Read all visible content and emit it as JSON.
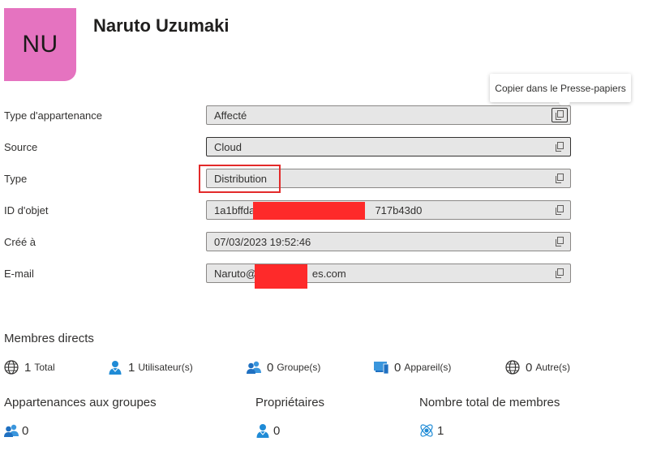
{
  "header": {
    "initials": "NU",
    "name": "Naruto Uzumaki"
  },
  "tooltip": "Copier dans le Presse-papiers",
  "fields": [
    {
      "label": "Type d'appartenance",
      "value": "Affecté"
    },
    {
      "label": "Source",
      "value": "Cloud"
    },
    {
      "label": "Type",
      "value": "Distribution"
    },
    {
      "label": "ID d'objet",
      "value": "1a1bffda                                         717b43d0"
    },
    {
      "label": "Créé à",
      "value": "07/03/2023 19:52:46"
    },
    {
      "label": "E-mail",
      "value": "Naruto@                   es.com"
    }
  ],
  "direct_members": {
    "title": "Membres directs",
    "stats": [
      {
        "icon": "globe-icon",
        "count": "1",
        "unit": "Total"
      },
      {
        "icon": "user-icon",
        "count": "1",
        "unit": "Utilisateur(s)"
      },
      {
        "icon": "group-icon",
        "count": "0",
        "unit": "Groupe(s)"
      },
      {
        "icon": "device-icon",
        "count": "0",
        "unit": "Appareil(s)"
      },
      {
        "icon": "globe-icon",
        "count": "0",
        "unit": "Autre(s)"
      }
    ]
  },
  "summary": [
    {
      "title": "Appartenances aux groupes",
      "icon": "group-icon",
      "count": "0"
    },
    {
      "title": "Propriétaires",
      "icon": "user-icon",
      "count": "0"
    },
    {
      "title": "Nombre total de membres",
      "icon": "members-icon",
      "count": "1"
    }
  ],
  "colors": {
    "avatar": "#e573c0",
    "highlight": "#e32a2a",
    "icon_blue": "#1f8bd6"
  }
}
